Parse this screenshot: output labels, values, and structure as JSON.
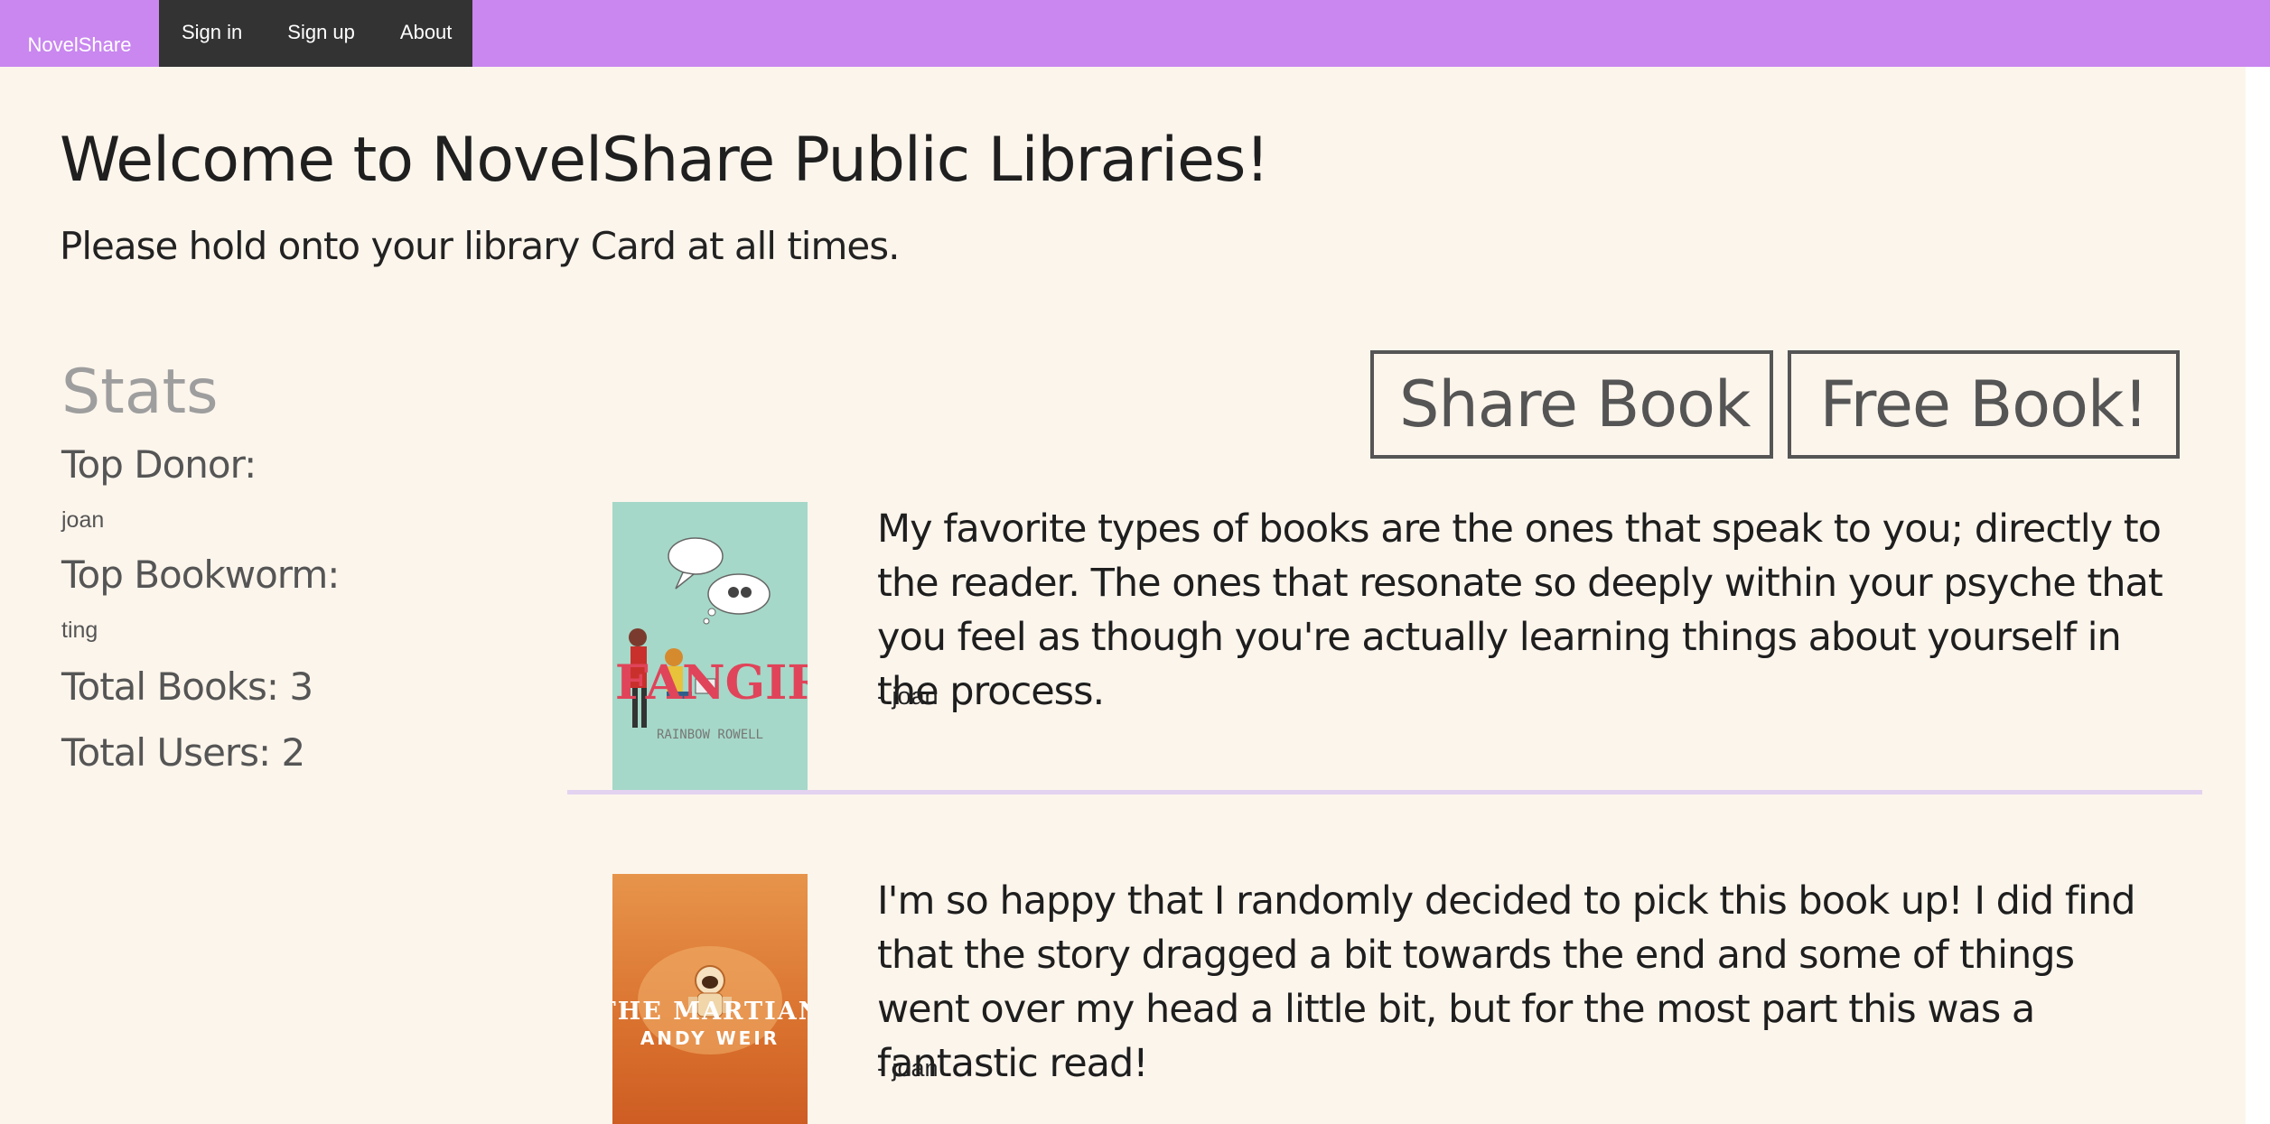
{
  "navbar": {
    "brand": "NovelShare",
    "links": [
      "Sign in",
      "Sign up",
      "About"
    ],
    "color": "#c987ef"
  },
  "hero": {
    "title": "Welcome to NovelShare Public Libraries!",
    "subtitle": "Please hold onto your library Card at all times."
  },
  "stats": {
    "heading": "Stats",
    "top_donor_label": "Top Donor:",
    "top_donor": "joan",
    "top_bookworm_label": "Top Bookworm:",
    "top_bookworm": "ting",
    "total_books": "Total Books: 3",
    "total_users": "Total Users: 2"
  },
  "actions": {
    "share_label": "Share Book",
    "free_label": "Free Book!"
  },
  "posts": [
    {
      "cover": {
        "title": "FANGIRL",
        "author": "RAINBOW ROWELL",
        "color": "#a5d8c8"
      },
      "text": "My favorite types of books are the ones that speak to you; directly to the reader. The ones that resonate so deeply within your psyche that you feel as though you're actually learning things about yourself in the process.",
      "author": "- joan"
    },
    {
      "cover": {
        "title": "THE MARTIAN",
        "author": "ANDY WEIR",
        "color": "#d9702d"
      },
      "text": "I'm so happy that I randomly decided to pick this book up! I did find that the story dragged a bit towards the end and some of things went over my head a little bit, but for the most part this was a fantastic read!",
      "author": "- joan"
    }
  ]
}
